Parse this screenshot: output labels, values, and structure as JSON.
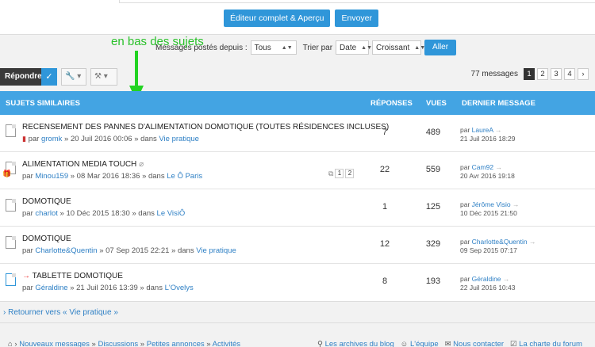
{
  "post_actions": {
    "full_editor": "Éditeur complet & Aperçu",
    "send": "Envoyer"
  },
  "annotation": "en bas des sujets",
  "filters": {
    "label_since": "Messages postés depuis :",
    "since_value": "Tous",
    "label_sort": "Trier par",
    "sort_value": "Date",
    "order_value": "Croissant",
    "go": "Aller"
  },
  "actionbar": {
    "reply": "Répondre",
    "message_count": "77 messages",
    "pages": [
      "1",
      "2",
      "3",
      "4"
    ],
    "next": "›"
  },
  "table": {
    "headers": {
      "topics": "SUJETS SIMILAIRES",
      "replies": "RÉPONSES",
      "views": "VUES",
      "last": "DERNIER MESSAGE"
    },
    "rows": [
      {
        "title": "RECENSEMENT DES PANNES D'ALIMENTATION DOMOTIQUE (TOUTES RÉSIDENCES INCLUSES)",
        "by": "par",
        "author": "gromk",
        "date": "» 20 Juil 2016 00:06 » dans",
        "forum": "Vie pratique",
        "replies": "7",
        "views": "489",
        "last_by": "par",
        "last_user": "LaureA",
        "last_date": "21 Juil 2016 18:29"
      },
      {
        "title": "ALIMENTATION MEDIA TOUCH",
        "by": "par",
        "author": "Minou159",
        "date": "» 08 Mar 2016 18:36 » dans",
        "forum": "Le Ô Paris",
        "replies": "22",
        "views": "559",
        "last_by": "par",
        "last_user": "Cam92",
        "last_date": "20 Avr 2016 19:18",
        "mini_pages": [
          "1",
          "2"
        ]
      },
      {
        "title": "DOMOTIQUE",
        "by": "par",
        "author": "charlot",
        "date": "» 10 Déc 2015 18:30 » dans",
        "forum": "Le VisiÔ",
        "replies": "1",
        "views": "125",
        "last_by": "par",
        "last_user": "Jérôme Visio",
        "last_date": "10 Déc 2015 21:50"
      },
      {
        "title": "DOMOTIQUE",
        "by": "par",
        "author": "Charlotte&Quentin",
        "date": "» 07 Sep 2015 22:21 » dans",
        "forum": "Vie pratique",
        "replies": "12",
        "views": "329",
        "last_by": "par",
        "last_user": "Charlotte&Quentin",
        "last_date": "09 Sep 2015 07:17"
      },
      {
        "title": "TABLETTE DOMOTIQUE",
        "by": "par",
        "author": "Géraldine",
        "date": "» 21 Juil 2016 13:39 » dans",
        "forum": "L'Ovelys",
        "replies": "8",
        "views": "193",
        "last_by": "par",
        "last_user": "Géraldine",
        "last_date": "22 Juil 2016 10:43"
      }
    ]
  },
  "return_link": "Retourner vers « Vie pratique »",
  "footer": {
    "left": [
      "Nouveaux messages",
      "Discussions",
      "Petites annonces",
      "Activités"
    ],
    "right": [
      "Les archives du blog",
      "L'équipe",
      "Nous contacter",
      "La charte du forum"
    ]
  },
  "colors": {
    "accent": "#43a4e3",
    "button": "#2f96d9",
    "annotation": "#22d322"
  }
}
